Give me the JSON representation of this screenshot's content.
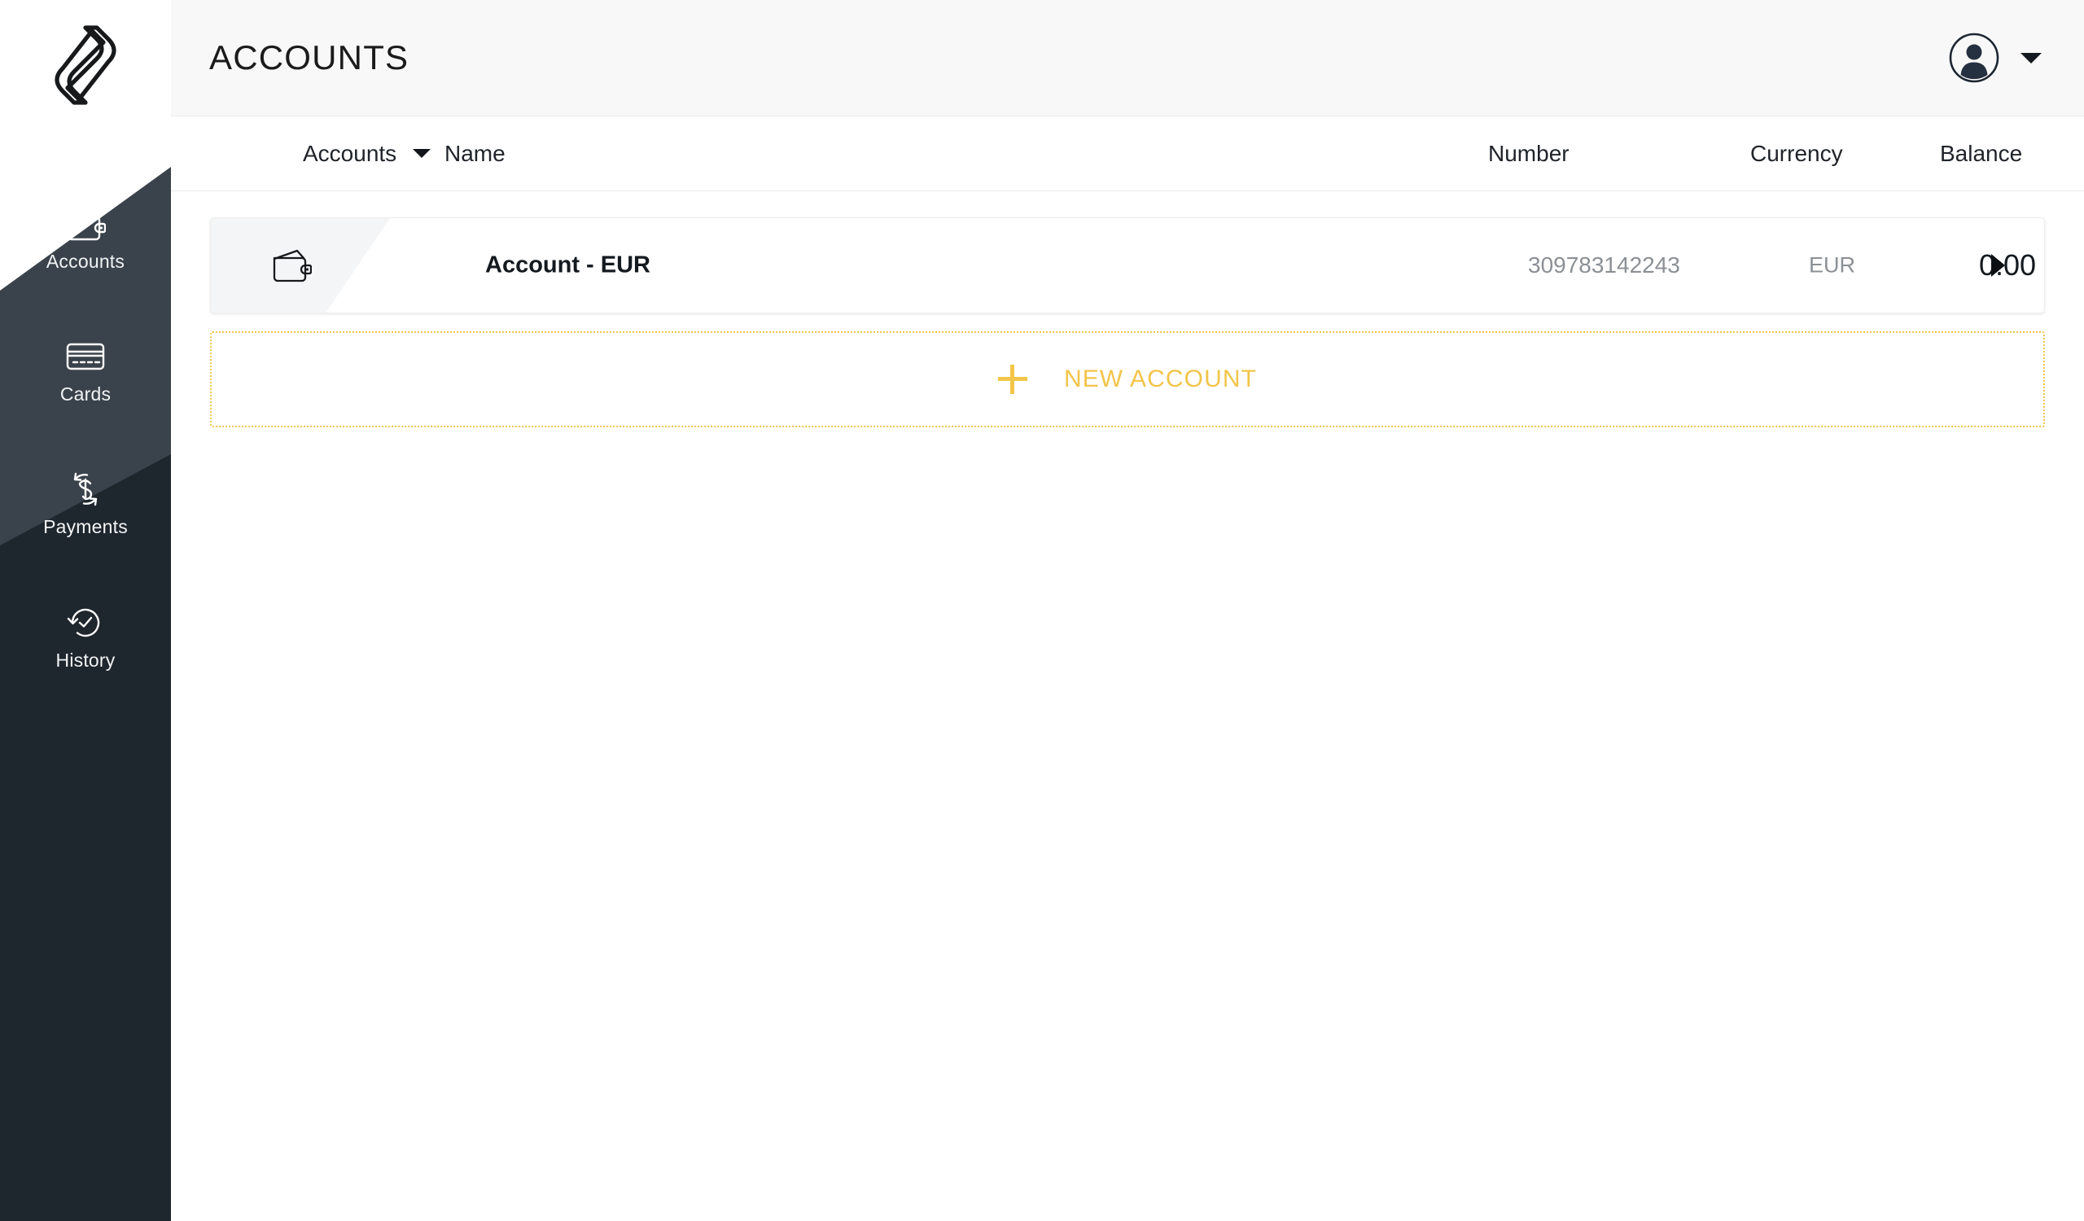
{
  "brand": {
    "logo_icon": "interlocking-s-logo",
    "colors": {
      "sidebar_dark": "#1e262e",
      "sidebar_active": "#3a434c",
      "accent_gold": "#f2c44a",
      "text_dark": "#141a1f",
      "text_muted": "#8b9095"
    }
  },
  "sidebar": {
    "items": [
      {
        "id": "accounts",
        "label": "Accounts",
        "icon": "wallet-icon",
        "active": true
      },
      {
        "id": "cards",
        "label": "Cards",
        "icon": "credit-card-icon",
        "active": false
      },
      {
        "id": "payments",
        "label": "Payments",
        "icon": "currency-exchange-icon",
        "active": false
      },
      {
        "id": "history",
        "label": "History",
        "icon": "clock-history-icon",
        "active": false
      }
    ]
  },
  "header": {
    "title": "ACCOUNTS",
    "avatar_icon": "user-avatar-icon",
    "caret_icon": "chevron-down-icon"
  },
  "table": {
    "filter": {
      "label": "Accounts",
      "caret_icon": "chevron-down-icon"
    },
    "columns": {
      "name": "Name",
      "number": "Number",
      "currency": "Currency",
      "balance": "Balance"
    },
    "rows": [
      {
        "icon": "wallet-icon",
        "name": "Account - EUR",
        "number": "309783142243",
        "currency": "EUR",
        "balance": "0.00",
        "arrow_icon": "chevron-right-icon"
      }
    ]
  },
  "new_account": {
    "label": "NEW ACCOUNT",
    "plus_icon": "plus-icon"
  }
}
